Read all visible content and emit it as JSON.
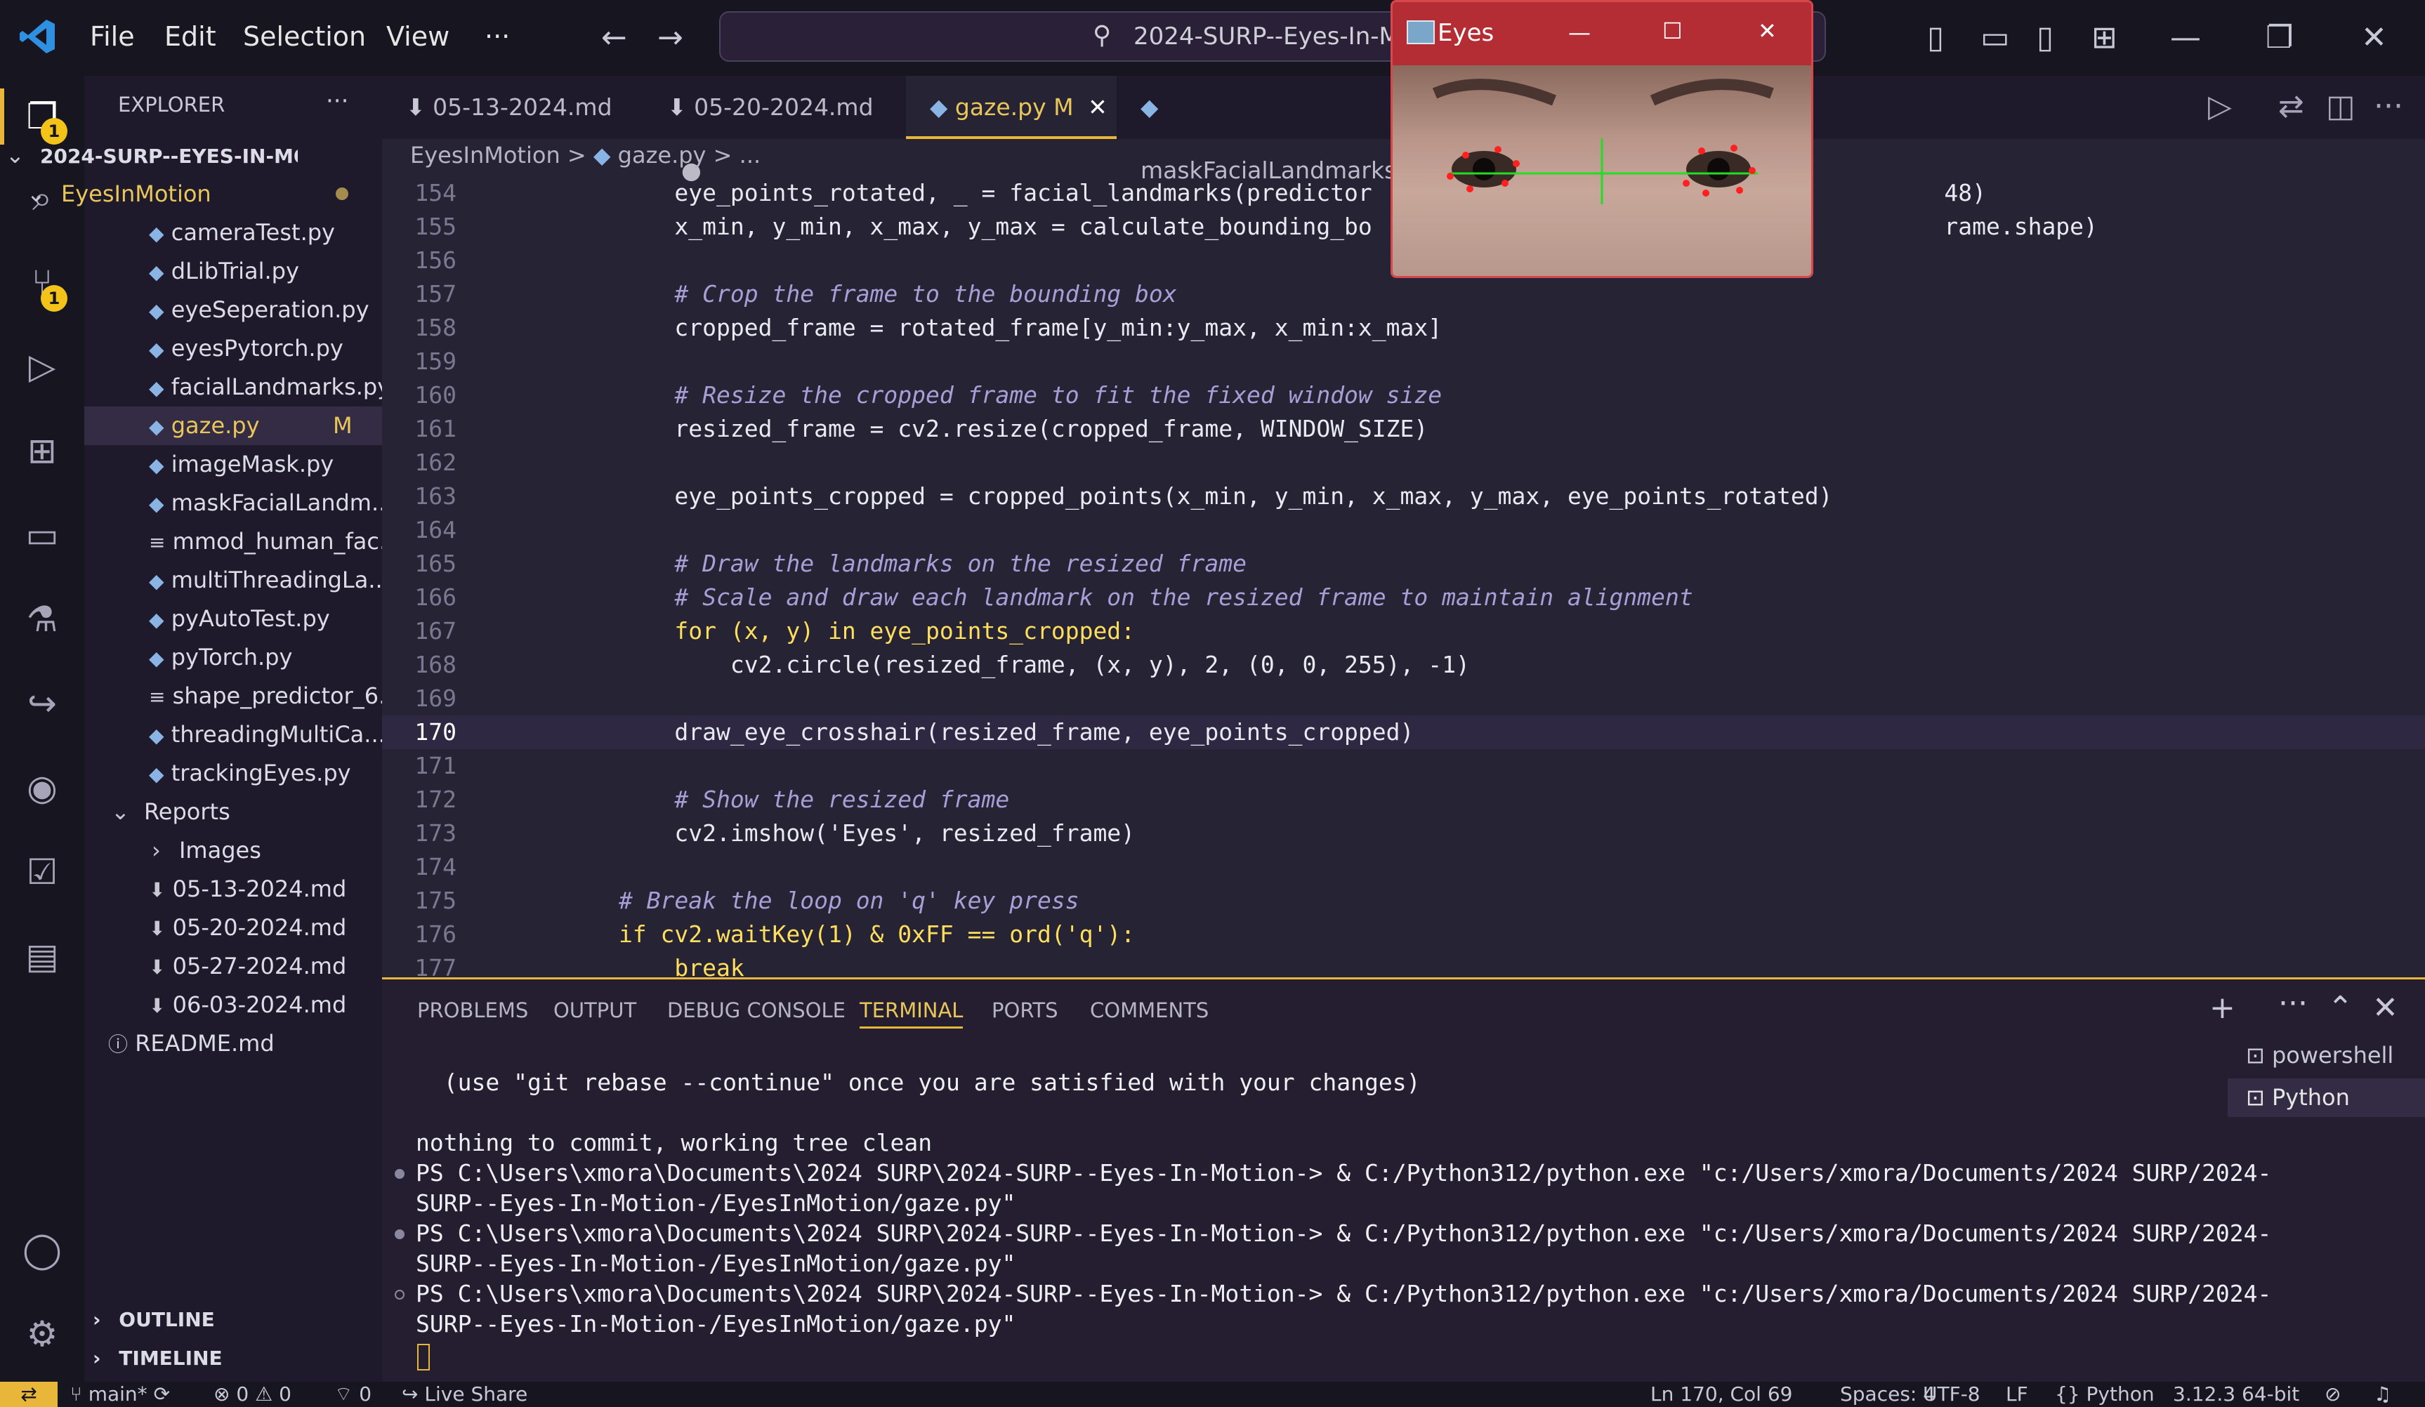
{
  "titlebar": {
    "menu": [
      "File",
      "Edit",
      "Selection",
      "View",
      "···"
    ],
    "search_text": "2024-SURP--Eyes-In-M"
  },
  "eyes_window": {
    "title": "Eyes",
    "min": "—",
    "max": "☐",
    "close": "✕"
  },
  "activity_badges": {
    "explorer": "1",
    "source_control": "1"
  },
  "sidebar": {
    "title": "EXPLORER",
    "workspace": "2024-SURP--EYES-IN-MOT...",
    "folder": "EyesInMotion",
    "files": [
      "cameraTest.py",
      "dLibTrial.py",
      "eyeSeperation.py",
      "eyesPytorch.py",
      "facialLandmarks.py",
      "gaze.py",
      "imageMask.py",
      "maskFacialLandm...",
      "mmod_human_fac...",
      "multiThreadingLa...",
      "pyAutoTest.py",
      "pyTorch.py",
      "shape_predictor_6...",
      "threadingMultiCa...",
      "trackingEyes.py"
    ],
    "modified_marker": "M",
    "reports_folder": "Reports",
    "images_folder": "Images",
    "reports": [
      "05-13-2024.md",
      "05-20-2024.md",
      "05-27-2024.md",
      "06-03-2024.md"
    ],
    "readme": "README.md",
    "outline": "OUTLINE",
    "timeline": "TIMELINE"
  },
  "tabs": [
    {
      "label": "05-13-2024.md"
    },
    {
      "label": "05-20-2024.md"
    },
    {
      "label": "gaze.py",
      "badge": "M"
    },
    {
      "label": "maskFacialLandmarks"
    }
  ],
  "breadcrumb": [
    "EyesInMotion",
    ">",
    "gaze.py",
    "> ..."
  ],
  "code": [
    {
      "n": "154",
      "t": "            eye_points_rotated, _ = facial_landmarks(predictor                                         48)"
    },
    {
      "n": "155",
      "t": "            x_min, y_min, x_max, y_max = calculate_bounding_bo                                         rame.shape)"
    },
    {
      "n": "156",
      "t": ""
    },
    {
      "n": "157",
      "t": "            # Crop the frame to the bounding box"
    },
    {
      "n": "158",
      "t": "            cropped_frame = rotated_frame[y_min:y_max, x_min:x_max]"
    },
    {
      "n": "159",
      "t": ""
    },
    {
      "n": "160",
      "t": "            # Resize the cropped frame to fit the fixed window size"
    },
    {
      "n": "161",
      "t": "            resized_frame = cv2.resize(cropped_frame, WINDOW_SIZE)"
    },
    {
      "n": "162",
      "t": ""
    },
    {
      "n": "163",
      "t": "            eye_points_cropped = cropped_points(x_min, y_min, x_max, y_max, eye_points_rotated)"
    },
    {
      "n": "164",
      "t": ""
    },
    {
      "n": "165",
      "t": "            # Draw the landmarks on the resized frame"
    },
    {
      "n": "166",
      "t": "            # Scale and draw each landmark on the resized frame to maintain alignment"
    },
    {
      "n": "167",
      "t": "            for (x, y) in eye_points_cropped:"
    },
    {
      "n": "168",
      "t": "                cv2.circle(resized_frame, (x, y), 2, (0, 0, 255), -1)"
    },
    {
      "n": "169",
      "t": ""
    },
    {
      "n": "170",
      "t": "            draw_eye_crosshair(resized_frame, eye_points_cropped)"
    },
    {
      "n": "171",
      "t": ""
    },
    {
      "n": "172",
      "t": "            # Show the resized frame"
    },
    {
      "n": "173",
      "t": "            cv2.imshow('Eyes', resized_frame)"
    },
    {
      "n": "174",
      "t": ""
    },
    {
      "n": "175",
      "t": "        # Break the loop on 'q' key press"
    },
    {
      "n": "176",
      "t": "        if cv2.waitKey(1) & 0xFF == ord('q'):"
    },
    {
      "n": "177",
      "t": "            break"
    }
  ],
  "panel_tabs": [
    "PROBLEMS",
    "OUTPUT",
    "DEBUG CONSOLE",
    "TERMINAL",
    "PORTS",
    "COMMENTS"
  ],
  "terminal": [
    "  (use \"git rebase --continue\" once you are satisfied with your changes)",
    "",
    "nothing to commit, working tree clean",
    "PS C:\\Users\\xmora\\Documents\\2024 SURP\\2024-SURP--Eyes-In-Motion-> & C:/Python312/python.exe \"c:/Users/xmora/Documents/2024 SURP/2024-",
    "SURP--Eyes-In-Motion-/EyesInMotion/gaze.py\"",
    "PS C:\\Users\\xmora\\Documents\\2024 SURP\\2024-SURP--Eyes-In-Motion-> & C:/Python312/python.exe \"c:/Users/xmora/Documents/2024 SURP/2024-",
    "SURP--Eyes-In-Motion-/EyesInMotion/gaze.py\"",
    "PS C:\\Users\\xmora\\Documents\\2024 SURP\\2024-SURP--Eyes-In-Motion-> & C:/Python312/python.exe \"c:/Users/xmora/Documents/2024 SURP/2024-",
    "SURP--Eyes-In-Motion-/EyesInMotion/gaze.py\""
  ],
  "terminal_list": [
    "powershell",
    "Python"
  ],
  "status": {
    "branch": "main*",
    "errors": "0",
    "warnings": "0",
    "ports": "0",
    "live_share": "Live Share",
    "position": "Ln 170, Col 69",
    "spaces": "Spaces: 4",
    "encoding": "UTF-8",
    "eol": "LF",
    "language": "Python",
    "interpreter": "3.12.3 64-bit"
  },
  "colors": {
    "accent": "#e8b73a",
    "keyword": "#fede5d",
    "function": "#36f9f6",
    "comment": "#a89fd7"
  }
}
